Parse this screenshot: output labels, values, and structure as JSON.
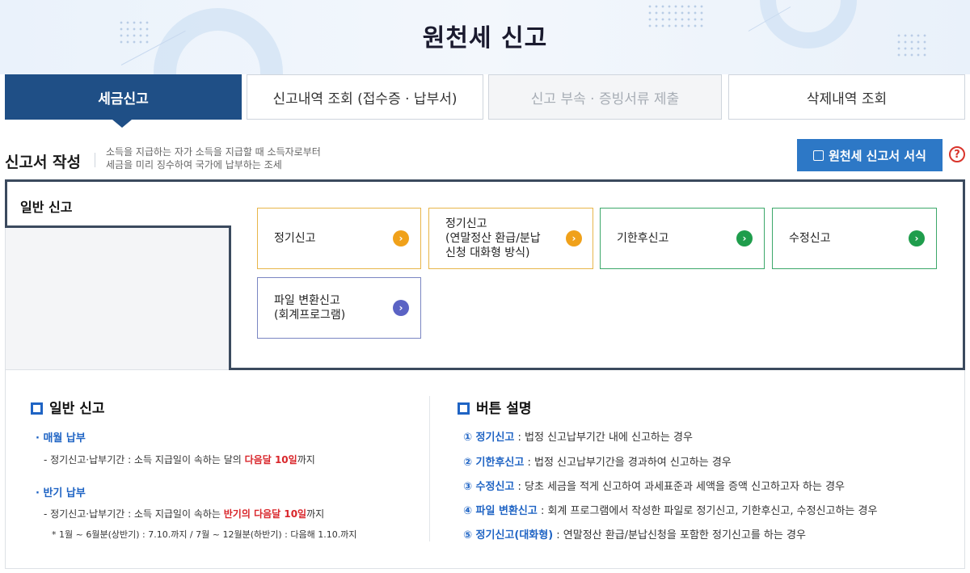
{
  "page_title": "원천세 신고",
  "tabs": [
    {
      "label": "세금신고"
    },
    {
      "label": "신고내역 조회 (접수증 · 납부서)"
    },
    {
      "label": "신고 부속 · 증빙서류 제출"
    },
    {
      "label": "삭제내역 조회"
    }
  ],
  "section": {
    "title": "신고서 작성",
    "desc_line1": "소득을 지급하는 자가 소득을 지급할 때 소득자로부터",
    "desc_line2": "세금을 미리 징수하여 국가에 납부하는 조세",
    "form_button": "원천세 신고서 서식",
    "help": "?"
  },
  "panel": {
    "tab_label": "일반 신고",
    "options": [
      {
        "label": "정기신고",
        "color": "#f0a11a"
      },
      {
        "label": "정기신고\n(연말정산 환급/분납\n신청 대화형 방식)",
        "color": "#f0a11a"
      },
      {
        "label": "기한후신고",
        "color": "#1f9d4c"
      },
      {
        "label": "수정신고",
        "color": "#1f9d4c"
      },
      {
        "label": "파일 변환신고\n(회계프로그램)",
        "color": "#5b63c4"
      }
    ],
    "go_glyph": "›"
  },
  "info_left": {
    "title": "일반 신고",
    "monthly_title": "· 매월 납부",
    "monthly_line_pre": "- 정기신고·납부기간 : 소득 지급일이 속하는 달의 ",
    "monthly_line_red": "다음달 10일",
    "monthly_line_post": "까지",
    "half_title": "· 반기 납부",
    "half_line_pre": "- 정기신고·납부기간 : 소득 지급일이 속하는 ",
    "half_line_red": "반기의 다음달 10일",
    "half_line_post": "까지",
    "half_note": "* 1월 ~ 6월분(상반기) : 7.10.까지 / 7월 ~ 12월분(하반기) : 다음해 1.10.까지"
  },
  "info_right": {
    "title": "버튼 설명",
    "items": [
      {
        "key": "① 정기신고",
        "text": " : 법정 신고납부기간 내에 신고하는 경우"
      },
      {
        "key": "② 기한후신고",
        "text": " : 법정 신고납부기간을 경과하여 신고하는 경우"
      },
      {
        "key": "③ 수정신고",
        "text": " : 당초 세금을 적게 신고하여 과세표준과 세액을 증액 신고하고자 하는 경우"
      },
      {
        "key": "④ 파일 변환신고",
        "text": " : 회계 프로그램에서 작성한 파일로 정기신고, 기한후신고, 수정신고하는 경우"
      },
      {
        "key": "⑤ 정기신고(대화형)",
        "text": " : 연말정산 환급/분납신청을 포함한 정기신고를 하는 경우"
      }
    ]
  }
}
